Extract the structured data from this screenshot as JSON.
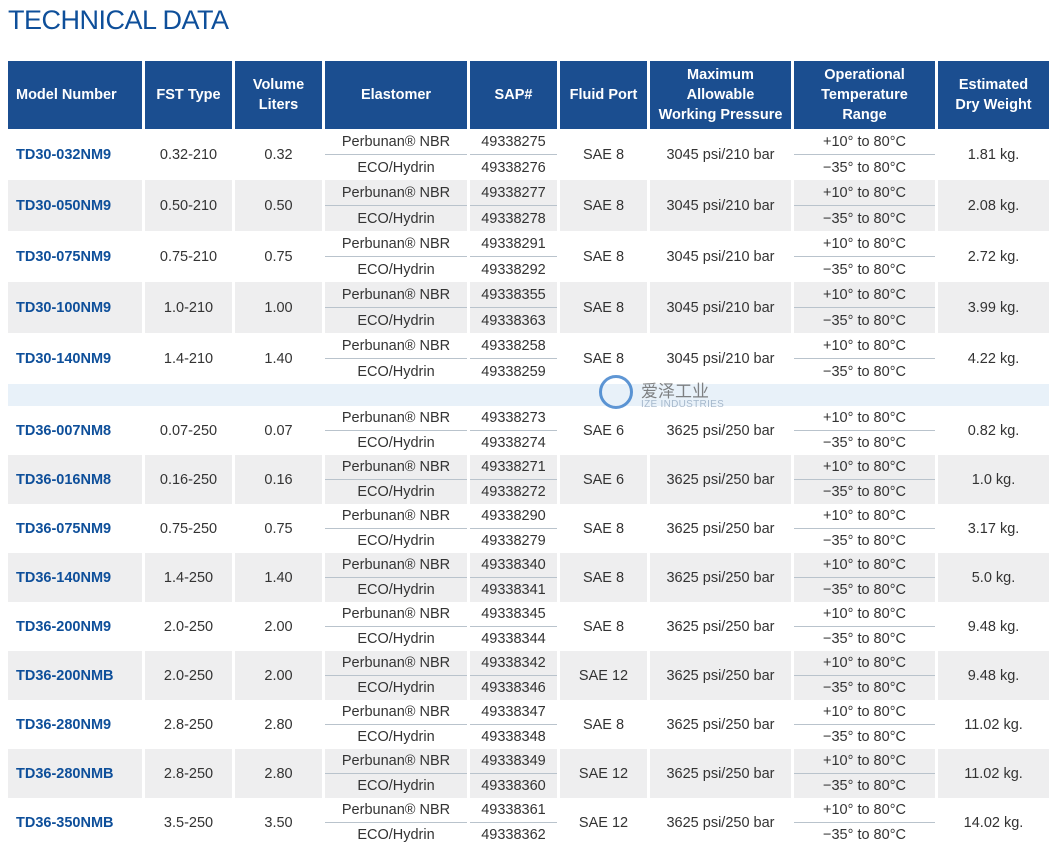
{
  "title": "TECHNICAL DATA",
  "headers": {
    "model": "Model Number",
    "fst": "FST Type",
    "volume": [
      "Volume",
      "Liters"
    ],
    "elastomer": "Elastomer",
    "sap": "SAP#",
    "port": "Fluid Port",
    "pressure": [
      "Maximum",
      "Allowable",
      "Working Pressure"
    ],
    "temp": [
      "Operational",
      "Temperature",
      "Range"
    ],
    "weight": [
      "Estimated",
      "Dry Weight"
    ]
  },
  "elastomers": [
    "Perbunan® NBR",
    "ECO/Hydrin"
  ],
  "temps": [
    "+10° to 80°C",
    "−35° to 80°C"
  ],
  "groups": [
    [
      {
        "model": "TD30-032NM9",
        "fst": "0.32-210",
        "volume": "0.32",
        "sap": [
          "49338275",
          "49338276"
        ],
        "port": "SAE 8",
        "pressure": "3045 psi/210 bar",
        "weight": "1.81 kg."
      },
      {
        "model": "TD30-050NM9",
        "fst": "0.50-210",
        "volume": "0.50",
        "sap": [
          "49338277",
          "49338278"
        ],
        "port": "SAE 8",
        "pressure": "3045 psi/210 bar",
        "weight": "2.08 kg."
      },
      {
        "model": "TD30-075NM9",
        "fst": "0.75-210",
        "volume": "0.75",
        "sap": [
          "49338291",
          "49338292"
        ],
        "port": "SAE 8",
        "pressure": "3045 psi/210 bar",
        "weight": "2.72 kg."
      },
      {
        "model": "TD30-100NM9",
        "fst": "1.0-210",
        "volume": "1.00",
        "sap": [
          "49338355",
          "49338363"
        ],
        "port": "SAE 8",
        "pressure": "3045 psi/210 bar",
        "weight": "3.99 kg."
      },
      {
        "model": "TD30-140NM9",
        "fst": "1.4-210",
        "volume": "1.40",
        "sap": [
          "49338258",
          "49338259"
        ],
        "port": "SAE 8",
        "pressure": "3045 psi/210 bar",
        "weight": "4.22 kg."
      }
    ],
    [
      {
        "model": "TD36-007NM8",
        "fst": "0.07-250",
        "volume": "0.07",
        "sap": [
          "49338273",
          "49338274"
        ],
        "port": "SAE 6",
        "pressure": "3625 psi/250 bar",
        "weight": "0.82 kg."
      },
      {
        "model": "TD36-016NM8",
        "fst": "0.16-250",
        "volume": "0.16",
        "sap": [
          "49338271",
          "49338272"
        ],
        "port": "SAE 6",
        "pressure": "3625 psi/250 bar",
        "weight": "1.0 kg."
      },
      {
        "model": "TD36-075NM9",
        "fst": "0.75-250",
        "volume": "0.75",
        "sap": [
          "49338290",
          "49338279"
        ],
        "port": "SAE 8",
        "pressure": "3625 psi/250 bar",
        "weight": "3.17 kg."
      },
      {
        "model": "TD36-140NM9",
        "fst": "1.4-250",
        "volume": "1.40",
        "sap": [
          "49338340",
          "49338341"
        ],
        "port": "SAE 8",
        "pressure": "3625 psi/250 bar",
        "weight": "5.0 kg."
      },
      {
        "model": "TD36-200NM9",
        "fst": "2.0-250",
        "volume": "2.00",
        "sap": [
          "49338345",
          "49338344"
        ],
        "port": "SAE 8",
        "pressure": "3625 psi/250 bar",
        "weight": "9.48 kg."
      },
      {
        "model": "TD36-200NMB",
        "fst": "2.0-250",
        "volume": "2.00",
        "sap": [
          "49338342",
          "49338346"
        ],
        "port": "SAE 12",
        "pressure": "3625 psi/250 bar",
        "weight": "9.48 kg."
      },
      {
        "model": "TD36-280NM9",
        "fst": "2.8-250",
        "volume": "2.80",
        "sap": [
          "49338347",
          "49338348"
        ],
        "port": "SAE 8",
        "pressure": "3625 psi/250 bar",
        "weight": "11.02 kg."
      },
      {
        "model": "TD36-280NMB",
        "fst": "2.8-250",
        "volume": "2.80",
        "sap": [
          "49338349",
          "49338360"
        ],
        "port": "SAE 12",
        "pressure": "3625 psi/250 bar",
        "weight": "11.02 kg."
      },
      {
        "model": "TD36-350NMB",
        "fst": "3.5-250",
        "volume": "3.50",
        "sap": [
          "49338361",
          "49338362"
        ],
        "port": "SAE 12",
        "pressure": "3625 psi/250 bar",
        "weight": "14.02 kg."
      }
    ]
  ],
  "watermark": {
    "cn": "爱泽工业",
    "en": "IZE INDUSTRIES"
  },
  "colors": {
    "header_bg": "#1b4e90",
    "title": "#0e4f9a",
    "row_alt": "#eeeeef",
    "gap": "#e8f1f9"
  }
}
